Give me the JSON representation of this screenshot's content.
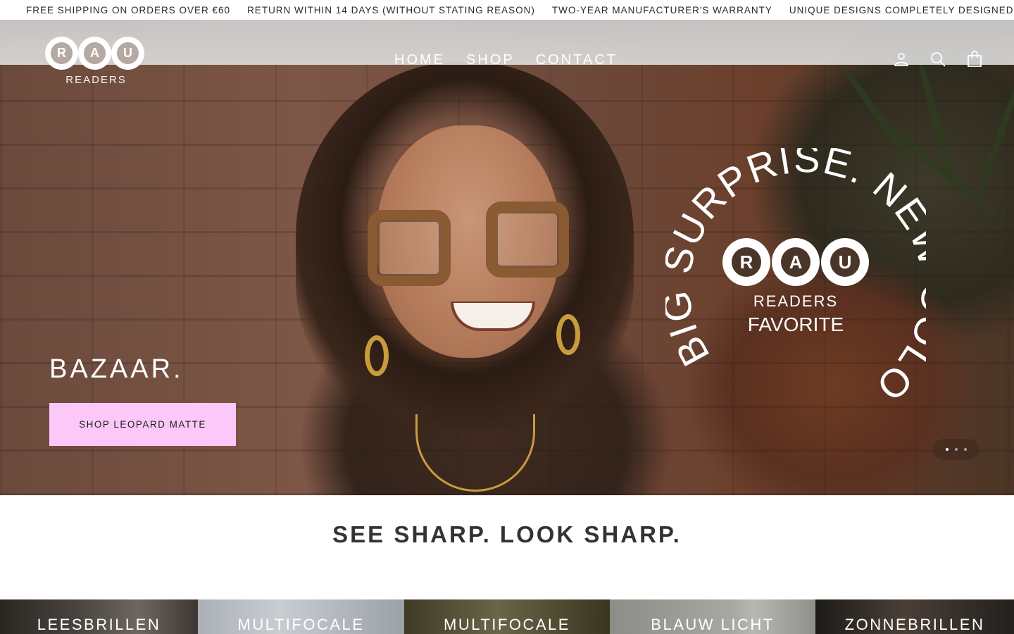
{
  "announcement": {
    "items": [
      "FREE SHIPPING ON ORDERS OVER €60",
      "RETURN WITHIN 14 DAYS (WITHOUT STATING REASON)",
      "TWO-YEAR MANUFACTURER'S WARRANTY",
      "UNIQUE DESIGNS COMPLETELY DESIGNED IN THE"
    ]
  },
  "header": {
    "logo": {
      "letters": [
        "R",
        "A",
        "U"
      ],
      "subtitle": "READERS"
    },
    "nav": [
      "HOME",
      "SHOP",
      "CONTACT"
    ],
    "icons": [
      "account-icon",
      "search-icon",
      "cart-icon"
    ]
  },
  "hero": {
    "title": "BAZAAR.",
    "cta_label": "SHOP LEOPARD MATTE",
    "cta_color": "#fcc8fa",
    "badge": {
      "ring_text": "BIG SURPRISE. NEW COLOR.",
      "letters": [
        "R",
        "A",
        "U"
      ],
      "line1": "READERS",
      "line2": "FAVORITE"
    },
    "slides": {
      "count": 3,
      "active": 1
    }
  },
  "tagline": "SEE SHARP. LOOK SHARP.",
  "categories": [
    "LEESBRILLEN",
    "MULTIFOCALE",
    "MULTIFOCALE",
    "BLAUW LICHT",
    "ZONNEBRILLEN"
  ]
}
